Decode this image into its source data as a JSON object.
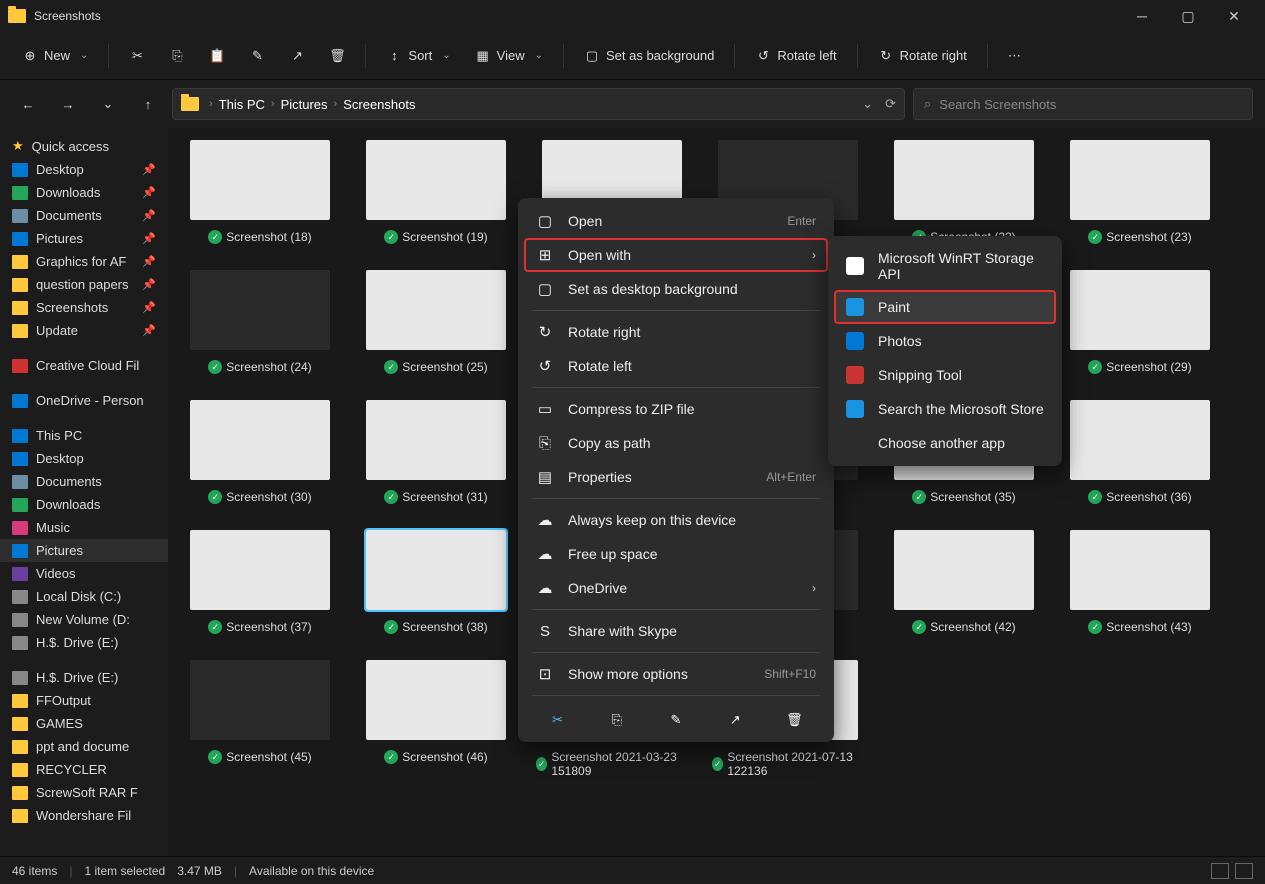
{
  "window": {
    "title": "Screenshots"
  },
  "toolbar": {
    "new": "New",
    "sort": "Sort",
    "view": "View",
    "set_bg": "Set as background",
    "rotate_left": "Rotate left",
    "rotate_right": "Rotate right"
  },
  "breadcrumb": {
    "parts": [
      "This PC",
      "Pictures",
      "Screenshots"
    ]
  },
  "search": {
    "placeholder": "Search Screenshots"
  },
  "sidebar": {
    "quick_access": "Quick access",
    "pinned": [
      {
        "label": "Desktop",
        "icon_bg": "#0078d4"
      },
      {
        "label": "Downloads",
        "icon_bg": "#23a55a"
      },
      {
        "label": "Documents",
        "icon_bg": "#6b8ea4"
      },
      {
        "label": "Pictures",
        "icon_bg": "#0078d4"
      },
      {
        "label": "Graphics for AF",
        "icon_bg": "#ffc83d"
      },
      {
        "label": "question papers",
        "icon_bg": "#ffc83d"
      },
      {
        "label": "Screenshots",
        "icon_bg": "#ffc83d"
      },
      {
        "label": "Update",
        "icon_bg": "#ffc83d"
      }
    ],
    "creative": "Creative Cloud Fil",
    "onedrive": "OneDrive - Person",
    "thispc": "This PC",
    "thispc_items": [
      {
        "label": "Desktop",
        "icon_bg": "#0078d4"
      },
      {
        "label": "Documents",
        "icon_bg": "#6b8ea4"
      },
      {
        "label": "Downloads",
        "icon_bg": "#23a55a"
      },
      {
        "label": "Music",
        "icon_bg": "#d83b7d"
      },
      {
        "label": "Pictures",
        "icon_bg": "#0078d4",
        "selected": true
      },
      {
        "label": "Videos",
        "icon_bg": "#6b3fa0"
      },
      {
        "label": "Local Disk (C:)",
        "icon_bg": "#888"
      },
      {
        "label": "New Volume (D:",
        "icon_bg": "#888"
      },
      {
        "label": "H.$. Drive (E:)",
        "icon_bg": "#888"
      }
    ],
    "drive": "H.$. Drive (E:)",
    "drive_items": [
      {
        "label": "FFOutput"
      },
      {
        "label": "GAMES"
      },
      {
        "label": "ppt and docume"
      },
      {
        "label": "RECYCLER"
      },
      {
        "label": "ScrewSoft RAR F"
      },
      {
        "label": "Wondershare Fil"
      }
    ]
  },
  "files": [
    {
      "label": "Screenshot (18)",
      "bg": "light"
    },
    {
      "label": "Screenshot (19)",
      "bg": "light"
    },
    {
      "label": "",
      "bg": "light"
    },
    {
      "label": "",
      "bg": "dark"
    },
    {
      "label": "Screenshot (22)",
      "bg": "light"
    },
    {
      "label": "Screenshot (23)",
      "bg": "light"
    },
    {
      "label": "Screenshot (24)",
      "bg": "dark"
    },
    {
      "label": "Screenshot (25)",
      "bg": "light"
    },
    {
      "label": "",
      "bg": "dark"
    },
    {
      "label": "",
      "bg": "dark"
    },
    {
      "label": "",
      "bg": "light"
    },
    {
      "label": "Screenshot (29)",
      "bg": "light"
    },
    {
      "label": "Screenshot (30)",
      "bg": "light"
    },
    {
      "label": "Screenshot (31)",
      "bg": "light"
    },
    {
      "label": "",
      "bg": "dark"
    },
    {
      "label": "",
      "bg": "dark"
    },
    {
      "label": "Screenshot (35)",
      "bg": "light"
    },
    {
      "label": "Screenshot (36)",
      "bg": "light"
    },
    {
      "label": "Screenshot (37)",
      "bg": "light"
    },
    {
      "label": "Screenshot (38)",
      "bg": "light",
      "selected": true
    },
    {
      "label": "",
      "bg": "dark"
    },
    {
      "label": "",
      "bg": "dark"
    },
    {
      "label": "Screenshot (42)",
      "bg": "light"
    },
    {
      "label": "Screenshot (43)",
      "bg": "light"
    },
    {
      "label": "Screenshot (45)",
      "bg": "dark"
    },
    {
      "label": "Screenshot (46)",
      "bg": "light"
    },
    {
      "label": "Screenshot 2021-03-23 151809",
      "bg": "dark"
    },
    {
      "label": "Screenshot 2021-07-13 122136",
      "bg": "light"
    }
  ],
  "context_menu": [
    {
      "label": "Open",
      "short": "Enter",
      "icon": "▢"
    },
    {
      "label": "Open with",
      "submenu": true,
      "highlight": true,
      "icon": "⊞"
    },
    {
      "label": "Set as desktop background",
      "icon": "▢"
    },
    {
      "sep": true
    },
    {
      "label": "Rotate right",
      "icon": "↻"
    },
    {
      "label": "Rotate left",
      "icon": "↺"
    },
    {
      "sep": true
    },
    {
      "label": "Compress to ZIP file",
      "icon": "▭"
    },
    {
      "label": "Copy as path",
      "icon": "⎘"
    },
    {
      "label": "Properties",
      "short": "Alt+Enter",
      "icon": "▤"
    },
    {
      "sep": true
    },
    {
      "label": "Always keep on this device",
      "icon": "☁"
    },
    {
      "label": "Free up space",
      "icon": "☁"
    },
    {
      "label": "OneDrive",
      "submenu": true,
      "icon": "☁"
    },
    {
      "sep": true
    },
    {
      "label": "Share with Skype",
      "icon": "S"
    },
    {
      "sep": true
    },
    {
      "label": "Show more options",
      "short": "Shift+F10",
      "icon": "⊡"
    }
  ],
  "submenu_items": [
    {
      "label": "Microsoft WinRT Storage API",
      "color": "#fff"
    },
    {
      "label": "Paint",
      "color": "#1a93e0",
      "highlight": true
    },
    {
      "label": "Photos",
      "color": "#0078d4"
    },
    {
      "label": "Snipping Tool",
      "color": "#c93434"
    },
    {
      "label": "Search the Microsoft Store",
      "color": "#1a93e0"
    },
    {
      "label": "Choose another app",
      "color": "transparent"
    }
  ],
  "statusbar": {
    "count": "46 items",
    "selected": "1 item selected",
    "size": "3.47 MB",
    "status": "Available on this device"
  }
}
